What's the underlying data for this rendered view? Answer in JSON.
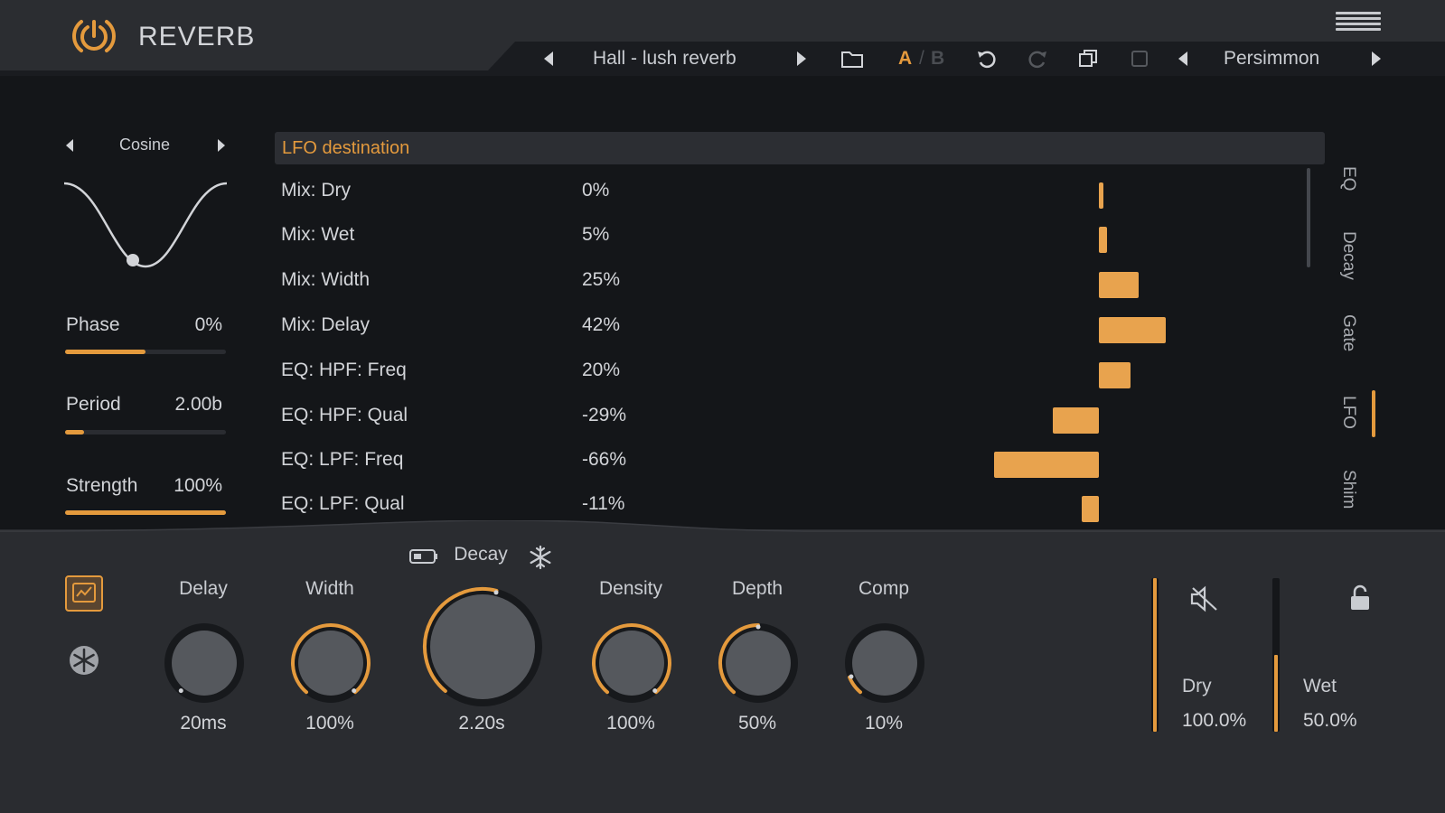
{
  "header": {
    "plugin_title": "REVERB",
    "preset_name": "Hall - lush reverb",
    "ab_a": "A",
    "ab_sep": "/",
    "ab_b": "B",
    "theme_name": "Persimmon"
  },
  "lfo": {
    "shape": "Cosine",
    "params": [
      {
        "label": "Phase",
        "value": "0%",
        "fill": 0.5
      },
      {
        "label": "Period",
        "value": "2.00b",
        "fill": 0.12
      },
      {
        "label": "Strength",
        "value": "100%",
        "fill": 1.0
      }
    ]
  },
  "destinations": {
    "header": "LFO destination",
    "rows": [
      {
        "name": "Mix: Dry",
        "value": "0%",
        "amount": 0
      },
      {
        "name": "Mix: Wet",
        "value": "5%",
        "amount": 5
      },
      {
        "name": "Mix: Width",
        "value": "25%",
        "amount": 25
      },
      {
        "name": "Mix: Delay",
        "value": "42%",
        "amount": 42
      },
      {
        "name": "EQ: HPF: Freq",
        "value": "20%",
        "amount": 20
      },
      {
        "name": "EQ: HPF: Qual",
        "value": "-29%",
        "amount": -29
      },
      {
        "name": "EQ: LPF: Freq",
        "value": "-66%",
        "amount": -66
      },
      {
        "name": "EQ: LPF: Qual",
        "value": "-11%",
        "amount": -11
      }
    ]
  },
  "side_tabs": [
    "EQ",
    "Decay",
    "Gate",
    "LFO",
    "Shim"
  ],
  "active_tab": "LFO",
  "decay_section": {
    "title": "Decay"
  },
  "knobs": [
    {
      "label": "Delay",
      "value": "20ms",
      "fraction": 0.0
    },
    {
      "label": "Width",
      "value": "100%",
      "fraction": 1.0
    },
    {
      "label": "Decay",
      "value": "2.20s",
      "fraction": 0.55
    },
    {
      "label": "Density",
      "value": "100%",
      "fraction": 1.0
    },
    {
      "label": "Depth",
      "value": "50%",
      "fraction": 0.5
    },
    {
      "label": "Comp",
      "value": "10%",
      "fraction": 0.1
    }
  ],
  "mix": {
    "dry_label": "Dry",
    "dry_value": "100.0%",
    "dry_level": 1.0,
    "wet_label": "Wet",
    "wet_value": "50.0%",
    "wet_level": 0.5
  },
  "colors": {
    "accent": "#e49a3d",
    "bar": "#e8a34e",
    "background": "#141619",
    "panel": "#2a2c30"
  },
  "icons": [
    "power-icon",
    "menu-icon",
    "arrow-left-icon",
    "arrow-right-icon",
    "folder-icon",
    "undo-icon",
    "redo-icon",
    "copy-icon",
    "paste-icon",
    "battery-icon",
    "snowflake-icon",
    "lock-icon",
    "mute-icon",
    "display-icon"
  ]
}
